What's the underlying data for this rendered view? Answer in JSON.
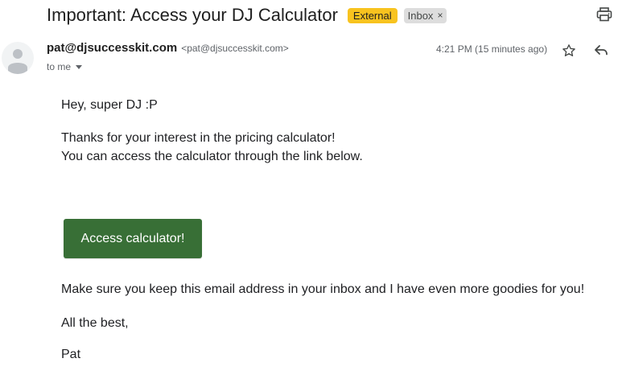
{
  "subject": "Important: Access your DJ Calculator",
  "labels": {
    "external": "External",
    "inbox": "Inbox",
    "inbox_remove": "×",
    "external_color": "#f8c31f"
  },
  "sender": {
    "name": "pat@djsuccesskit.com",
    "email": "<pat@djsuccesskit.com>",
    "to": "to me"
  },
  "timestamp": "4:21 PM (15 minutes ago)",
  "icons": {
    "print": "print-icon",
    "star": "star-icon",
    "reply": "reply-icon",
    "avatar": "person-icon",
    "to_expand": "caret-down-icon"
  },
  "body": {
    "greeting": "Hey, super DJ :P",
    "line1": "Thanks for your interest in the pricing calculator!",
    "line2": "You can access the calculator through the link below.",
    "cta_label": "Access calculator!",
    "cta_color": "#386f36",
    "line3": "Make sure you keep this email address in your inbox and I have even more goodies for you!",
    "signoff": "All the best,",
    "signature": "Pat"
  }
}
